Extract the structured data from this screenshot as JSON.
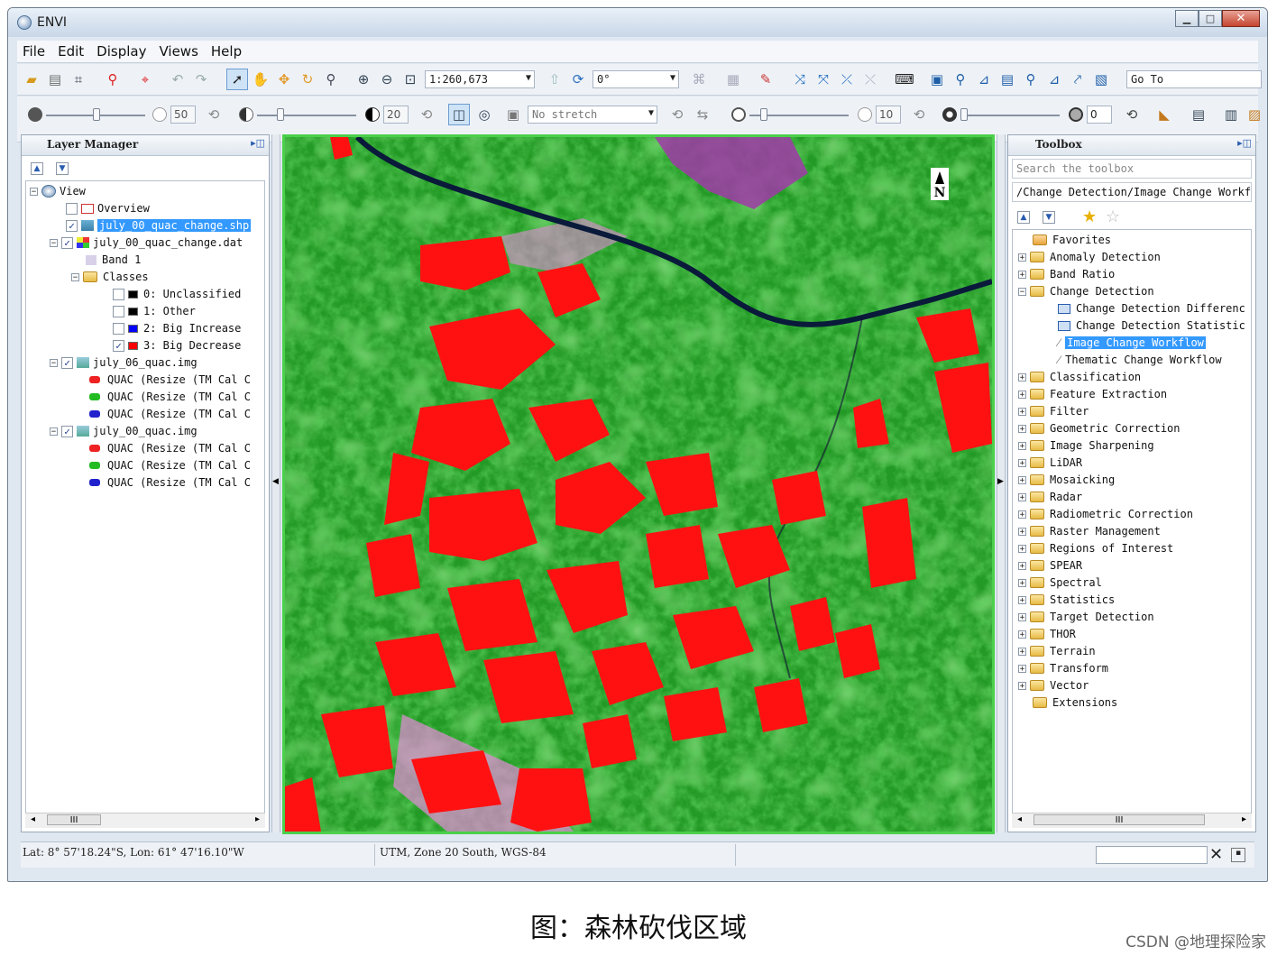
{
  "window": {
    "title": "ENVI"
  },
  "menu": [
    "File",
    "Edit",
    "Display",
    "Views",
    "Help"
  ],
  "toolbar": {
    "scale": "1:260,673",
    "rotation": "0°",
    "goto": "Go To",
    "stretch": "No stretch",
    "brightness": "50",
    "contrast": "20",
    "sharpen": "10",
    "transparency": "0"
  },
  "layer_manager": {
    "title": "Layer Manager",
    "items": [
      {
        "label": "View"
      },
      {
        "label": "Overview"
      },
      {
        "label": "july_00_quac_change.shp"
      },
      {
        "label": "july_00_quac_change.dat"
      },
      {
        "label": "Band 1"
      },
      {
        "label": "Classes"
      },
      {
        "label": "0: Unclassified"
      },
      {
        "label": "1: Other"
      },
      {
        "label": "2: Big Increase"
      },
      {
        "label": "3: Big Decrease"
      },
      {
        "label": "july_06_quac.img"
      },
      {
        "label": "QUAC (Resize (TM Cal C"
      },
      {
        "label": "QUAC (Resize (TM Cal C"
      },
      {
        "label": "QUAC (Resize (TM Cal C"
      },
      {
        "label": "july_00_quac.img"
      },
      {
        "label": "QUAC (Resize (TM Cal C"
      },
      {
        "label": "QUAC (Resize (TM Cal C"
      },
      {
        "label": "QUAC (Resize (TM Cal C"
      }
    ],
    "scroll_label": "III"
  },
  "class_colors": {
    "unclassified": "#000000",
    "other": "#000000",
    "big_increase": "#0000ff",
    "big_decrease": "#ff0000"
  },
  "toolbox": {
    "title": "Toolbox",
    "search_placeholder": "Search the toolbox",
    "path": "/Change Detection/Image Change Workf",
    "items": [
      {
        "label": "Favorites"
      },
      {
        "label": "Anomaly Detection"
      },
      {
        "label": "Band Ratio"
      },
      {
        "label": "Change Detection"
      },
      {
        "label": "Change Detection Differenc"
      },
      {
        "label": "Change Detection Statistic"
      },
      {
        "label": "Image Change Workflow"
      },
      {
        "label": "Thematic Change Workflow"
      },
      {
        "label": "Classification"
      },
      {
        "label": "Feature Extraction"
      },
      {
        "label": "Filter"
      },
      {
        "label": "Geometric Correction"
      },
      {
        "label": "Image Sharpening"
      },
      {
        "label": "LiDAR"
      },
      {
        "label": "Mosaicking"
      },
      {
        "label": "Radar"
      },
      {
        "label": "Radiometric Correction"
      },
      {
        "label": "Raster Management"
      },
      {
        "label": "Regions of Interest"
      },
      {
        "label": "SPEAR"
      },
      {
        "label": "Spectral"
      },
      {
        "label": "Statistics"
      },
      {
        "label": "Target Detection"
      },
      {
        "label": "THOR"
      },
      {
        "label": "Terrain"
      },
      {
        "label": "Transform"
      },
      {
        "label": "Vector"
      },
      {
        "label": "Extensions"
      }
    ],
    "scroll_label": "III"
  },
  "map": {
    "north_label": "N"
  },
  "status": {
    "latlon": "Lat: 8° 57'18.24\"S, Lon: 61° 47'16.10\"W",
    "projection": "UTM, Zone 20 South, WGS-84"
  },
  "caption": "图：森林砍伐区域",
  "watermark": "CSDN @地理探险家"
}
